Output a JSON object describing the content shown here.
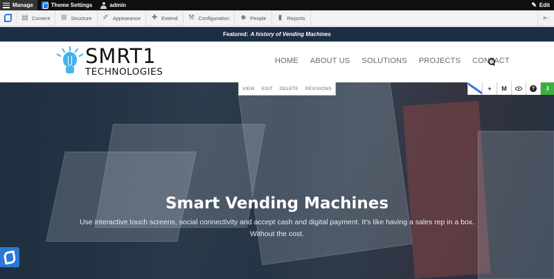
{
  "admin_bar": {
    "manage_label": "Manage",
    "theme_settings_label": "Theme Settings",
    "user_label": "admin",
    "edit_label": "Edit"
  },
  "toolbar": {
    "items": [
      {
        "label": "Content",
        "icon": "content-icon"
      },
      {
        "label": "Structure",
        "icon": "structure-icon"
      },
      {
        "label": "Appearance",
        "icon": "appearance-icon"
      },
      {
        "label": "Extend",
        "icon": "extend-icon"
      },
      {
        "label": "Configuration",
        "icon": "wrench-icon"
      },
      {
        "label": "People",
        "icon": "people-icon"
      },
      {
        "label": "Reports",
        "icon": "reports-icon"
      }
    ]
  },
  "featured": {
    "prefix": "Featured:",
    "title": "A history of Vending Machines"
  },
  "brand": {
    "name": "SMRT1",
    "tagline": "TECHNOLOGIES",
    "accent": "#45b4e8"
  },
  "nav": {
    "items": [
      "HOME",
      "ABOUT US",
      "SOLUTIONS",
      "PROJECTS",
      "CONTACT"
    ]
  },
  "local_tasks": [
    "VIEW",
    "EDIT",
    "DELETE",
    "REVISIONS"
  ],
  "tray": {
    "icons": [
      "plus-icon",
      "move-icon",
      "eye-icon",
      "help-icon",
      "download-icon"
    ],
    "plus": "+",
    "move": "M",
    "help": "?",
    "download": "⭳"
  },
  "hero": {
    "title": "Smart Vending Machines",
    "subtitle": "Use interactive touch screens, social connectivity and accept cash and digital payment.  It's like having a sales rep in a box. Without the cost."
  },
  "colors": {
    "toolbar_blue": "#2a79d5",
    "featured_bg": "#1c2e44",
    "download_green": "#3fae3f"
  }
}
